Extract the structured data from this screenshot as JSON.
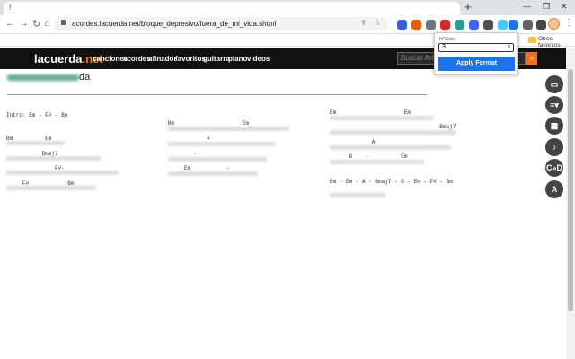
{
  "browser": {
    "tab_title": "!",
    "new_tab": "+",
    "minimize": "—",
    "maximize": "❐",
    "close": "✕",
    "url": "acordes.lacuerda.net/bloque_depresivo/fuera_de_mi_vida.shtml",
    "bookmarks_folder": "Otros favoritos"
  },
  "site": {
    "logo_main": "lacuerda",
    "logo_suffix": ".net",
    "nav": [
      "canciones",
      "acordes",
      "afinador",
      "favoritos",
      "guitarra",
      "piano",
      "videos"
    ],
    "search_placeholder": "Buscar Art",
    "search_btn": "»"
  },
  "song": {
    "title_suffix": "da",
    "intro": "Intro: Em - F# - Bm",
    "col1_chords": [
      "Bm          Em",
      "           Bmaj7",
      "               F#-",
      "     F#            Bm"
    ],
    "col2_chords": [
      "Bm                     Em",
      "            #",
      "        -",
      "     Em           -"
    ],
    "col3_chords": [
      "Em                     Em",
      "                                  Bmaj7",
      "             A",
      "      G    -          Em"
    ],
    "progression": "Bm - Em - A - Bmaj7 - G - Em - F# - Bm"
  },
  "popup": {
    "label": "N°Cols",
    "value": "3",
    "apply": "Apply Format"
  },
  "tools": [
    "▭",
    "≡▾",
    "▦",
    "♪",
    "C»D",
    "A"
  ]
}
